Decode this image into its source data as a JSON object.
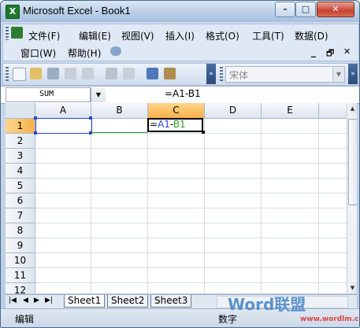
{
  "window": {
    "title": "Microsoft Excel - Book1",
    "minimize": "–",
    "maximize": "□",
    "close": "✕"
  },
  "menu": {
    "items": [
      "文件(F)",
      "编辑(E)",
      "视图(V)",
      "插入(I)",
      "格式(O)",
      "工具(T)",
      "数据(D)"
    ],
    "items2": [
      "窗口(W)",
      "帮助(H)"
    ],
    "doc_controls": [
      "_",
      "🗗",
      "✕"
    ]
  },
  "toolbar": {
    "font_name": "宋体"
  },
  "formula_bar": {
    "name_box": "SUM",
    "formula": "=A1-B1"
  },
  "sheet": {
    "columns": [
      "A",
      "B",
      "C",
      "D",
      "E"
    ],
    "rows": [
      "1",
      "2",
      "3",
      "4",
      "5",
      "6",
      "7",
      "8",
      "9",
      "10",
      "11",
      "12"
    ],
    "active_cell": "C1",
    "cells": {
      "C1": {
        "p1": "=",
        "p2": "A1",
        "p3": "-",
        "p4": "B1"
      }
    }
  },
  "tabs": {
    "items": [
      "Sheet1",
      "Sheet2",
      "Sheet3"
    ],
    "nav": [
      "|◀",
      "◀",
      "▶",
      "▶|"
    ]
  },
  "status": {
    "mode": "编辑",
    "num": "数字"
  },
  "watermark": {
    "text": "Word联盟",
    "url": "www.wordlm.com"
  },
  "colors": {
    "selection_blue": "#2f45c9",
    "selection_green": "#2c9a2c",
    "active_header": "#f5b14a"
  }
}
